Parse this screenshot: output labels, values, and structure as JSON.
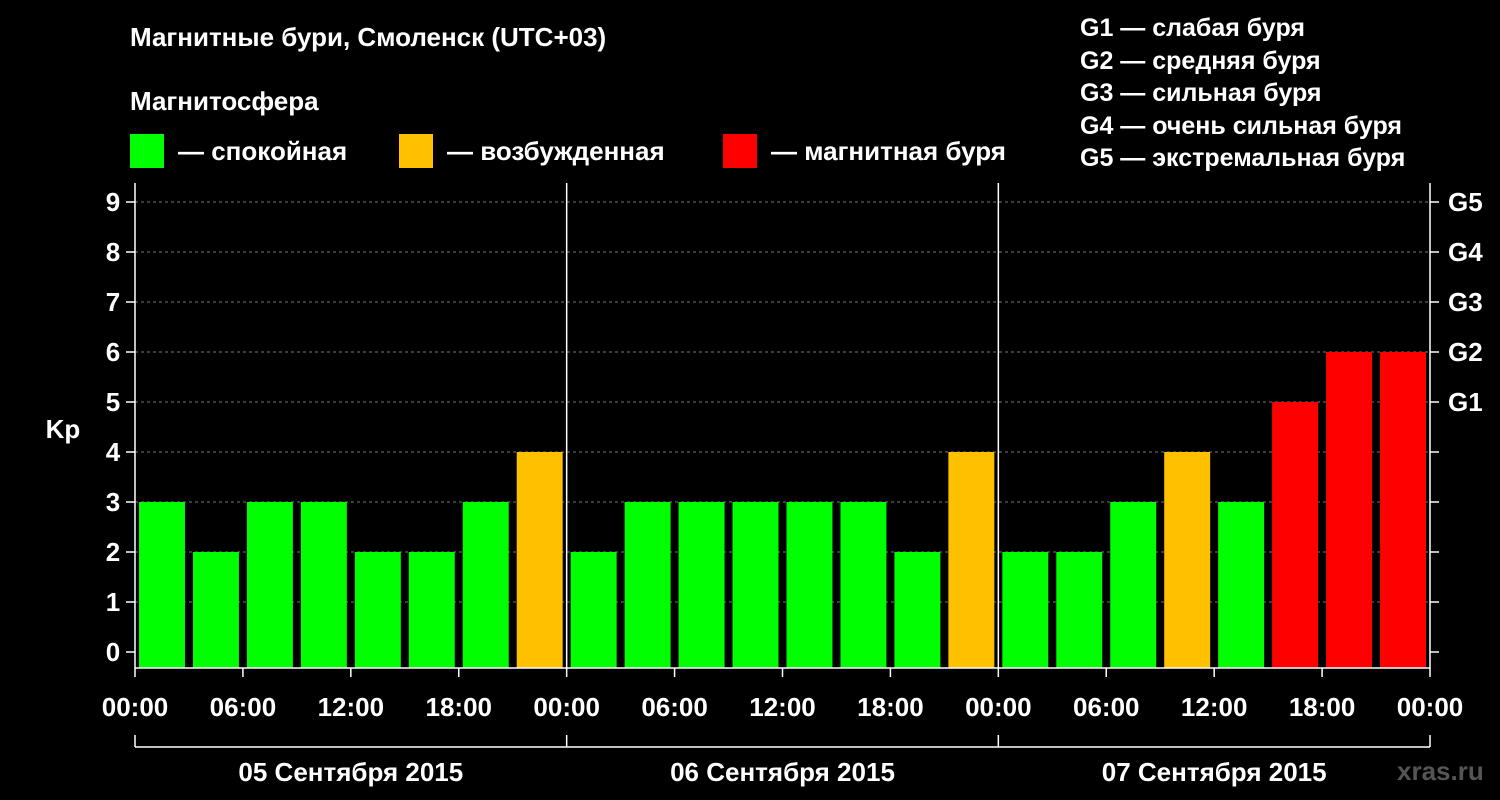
{
  "title": "Магнитные бури, Смоленск (UTC+03)",
  "subtitle": "Магнитосфера",
  "colors": {
    "calm": "#00ff00",
    "excited": "#ffc000",
    "storm": "#ff0000",
    "background": "#000000",
    "grid": "#777777"
  },
  "legend": [
    {
      "label": "— спокойная",
      "color": "#00ff00"
    },
    {
      "label": "— возбужденная",
      "color": "#ffc000"
    },
    {
      "label": "— магнитная буря",
      "color": "#ff0000"
    }
  ],
  "g_legend": [
    "G1 — слабая буря",
    "G2 — средняя буря",
    "G3 — сильная буря",
    "G4 — очень сильная буря",
    "G5 — экстремальная буря"
  ],
  "watermark": "xras.ru",
  "chart_data": {
    "type": "bar",
    "ylabel": "Kp",
    "ylim": [
      0,
      9
    ],
    "y_ticks": [
      0,
      1,
      2,
      3,
      4,
      5,
      6,
      7,
      8,
      9
    ],
    "right_ticks": [
      {
        "value": 5,
        "label": "G1"
      },
      {
        "value": 6,
        "label": "G2"
      },
      {
        "value": 7,
        "label": "G3"
      },
      {
        "value": 8,
        "label": "G4"
      },
      {
        "value": 9,
        "label": "G5"
      }
    ],
    "x_tick_labels": [
      "00:00",
      "06:00",
      "12:00",
      "18:00",
      "00:00",
      "06:00",
      "12:00",
      "18:00",
      "00:00",
      "06:00",
      "12:00",
      "18:00",
      "00:00"
    ],
    "days": [
      "05 Сентября 2015",
      "06 Сентября 2015",
      "07 Сентября 2015"
    ],
    "grid": "dashed horizontal",
    "values": [
      3,
      2,
      3,
      3,
      2,
      2,
      3,
      4,
      2,
      3,
      3,
      3,
      3,
      3,
      2,
      4,
      2,
      2,
      3,
      4,
      3,
      5,
      6,
      6
    ]
  }
}
